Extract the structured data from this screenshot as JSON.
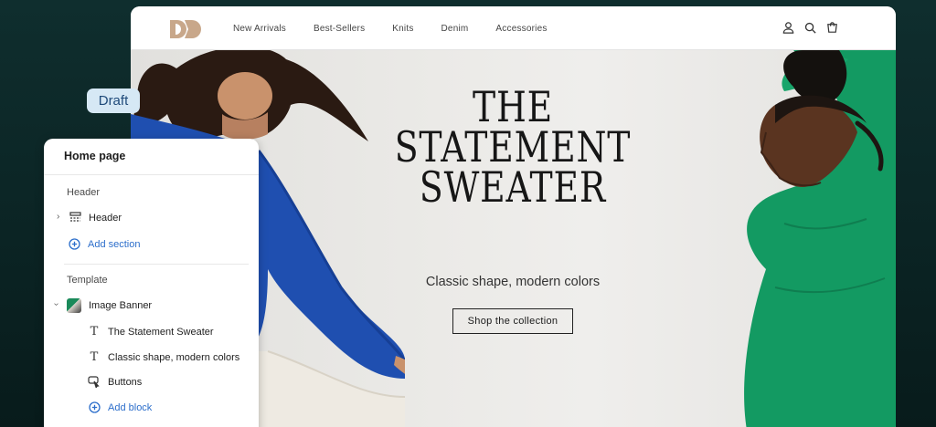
{
  "store": {
    "nav": [
      "New Arrivals",
      "Best-Sellers",
      "Knits",
      "Denim",
      "Accessories"
    ],
    "hero": {
      "title_lines": [
        "THE",
        "STATEMENT",
        "SWEATER"
      ],
      "subtitle": "Classic shape, modern colors",
      "cta": "Shop the collection"
    },
    "icons": [
      "user-icon",
      "search-icon",
      "cart-icon"
    ],
    "colors": {
      "left_sweater": "#1f4fb0",
      "right_sweater": "#139a62",
      "logo": "#c8a78a"
    }
  },
  "editor": {
    "badge": "Draft",
    "title": "Home page",
    "header_group": "Header",
    "header_item": "Header",
    "add_section": "Add section",
    "template_group": "Template",
    "banner_item": "Image Banner",
    "blocks": [
      "The Statement Sweater",
      "Classic shape, modern colors",
      "Buttons"
    ],
    "add_block": "Add block",
    "accent": "#2c6ecb"
  }
}
